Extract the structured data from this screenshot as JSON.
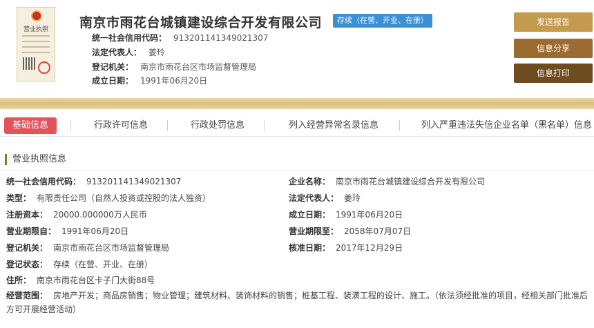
{
  "header": {
    "license_title": "营业执照",
    "company_name": "南京市雨花台城镇建设综合开发有限公司",
    "status_tag": "存续（在营、开业、在册）",
    "rows": [
      {
        "label": "统一社会信用代码：",
        "value": "913201141349021307"
      },
      {
        "label": "法定代表人：",
        "value": "姜玲"
      },
      {
        "label": "登记机关：",
        "value": "南京市雨花台区市场监督管理局"
      },
      {
        "label": "成立日期：",
        "value": "1991年06月20日"
      }
    ],
    "buttons": {
      "send": "发送报告",
      "share": "信息分享",
      "print": "信息打印"
    }
  },
  "tabs": [
    "基础信息",
    "行政许可信息",
    "行政处罚信息",
    "列入经营异常名录信息",
    "列入严重违法失信企业名单（黑名单）信息"
  ],
  "section": {
    "title": "营业执照信息",
    "fields": {
      "credit_code": {
        "label": "统一社会信用代码：",
        "value": "913201141349021307"
      },
      "name": {
        "label": "企业名称：",
        "value": "南京市雨花台城镇建设综合开发有限公司"
      },
      "type": {
        "label": "类型：",
        "value": "有限责任公司（自然人投资或控股的法人独资）"
      },
      "legal_rep": {
        "label": "法定代表人：",
        "value": "姜玲"
      },
      "capital": {
        "label": "注册资本：",
        "value": "20000.000000万人民币"
      },
      "established": {
        "label": "成立日期：",
        "value": "1991年06月20日"
      },
      "term_from": {
        "label": "营业期限自：",
        "value": "1991年06月20日"
      },
      "term_to": {
        "label": "营业期限至：",
        "value": "2058年07月07日"
      },
      "authority": {
        "label": "登记机关：",
        "value": "南京市雨花台区市场监督管理局"
      },
      "approval_date": {
        "label": "核准日期：",
        "value": "2017年12月29日"
      },
      "status": {
        "label": "登记状态：",
        "value": "存续（在营、开业、在册）"
      },
      "address": {
        "label": "住所：",
        "value": "南京市雨花台区卡子门大街88号"
      },
      "scope": {
        "label": "经营范围：",
        "value": "房地产开发；商品房销售；物业管理；建筑材料、装饰材料的销售；桩基工程、装潢工程的设计、施工。（依法须经批准的项目，经相关部门批准后方可开展经营活动）"
      }
    }
  }
}
